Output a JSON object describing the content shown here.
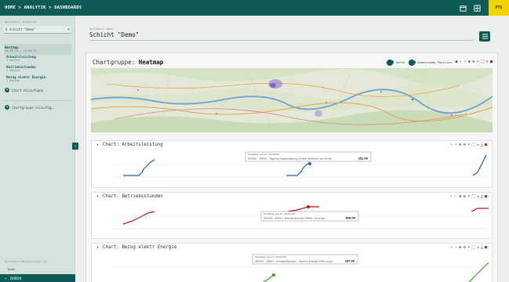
{
  "topbar": {
    "breadcrumb": "HOME > ANALYTIK > DASHBOARDS",
    "user": "PTS",
    "icons": [
      "calendar-icon",
      "grid-icon"
    ]
  },
  "sidebar": {
    "search_label": "Dashboard auswählen",
    "search_value": "Q Schicht \"Demo\"",
    "items": [
      {
        "label": "Heatmap",
        "sub": "20.05.25 - 19.05.25"
      },
      {
        "label": "Arbeitsleistung",
        "sub": "1 Balken"
      },
      {
        "label": "Betriebsstunden",
        "sub": "1 Balken"
      },
      {
        "label": "Bezug elektr Energie",
        "sub": "1 Balken"
      }
    ],
    "add_chart": "Chart hinzufügen",
    "add_group": "Chartgruppe hinzufüg…",
    "foot_text": "Dashboard-Reihenfolge (2)",
    "foot_text2": "Demo",
    "back_label": "ZURÜCK"
  },
  "dashboard": {
    "label": "Dashboard Name",
    "name": "Schicht \"Demo\""
  },
  "group": {
    "title_prefix": "Chartgruppe: ",
    "title_name": "Heatmap",
    "toggle1": "Karte",
    "toggle2": "Gemeinsame Position"
  },
  "charts": [
    {
      "title": "Chart:  Arbeitsleistung",
      "tooltip_date": "Samstag, Jan 11, 00:00:00",
      "tooltip_text": "Z00001 - Z0001 - Tägliche Arbeitsleistung (Quelle: Einheiten am Gerät)",
      "tooltip_value": "252.00"
    },
    {
      "title": "Chart:  Betriebsstunden",
      "tooltip_date": "Samstag, Jan 11, 00:00:00",
      "tooltip_text": "Z00001 - Z0001 - Betriebsstunden (Mittel, 1d (avg))",
      "tooltip_value": "898.00"
    },
    {
      "title": "Chart:  Bezug elektr Energie",
      "tooltip_date": "Samstag, Jan 11, 00:00:00",
      "tooltip_text": "Z00001 - Z0001 - Energie Bezugen - Tägliche Energie (kWh) (avg)",
      "tooltip_value": "187.00"
    }
  ],
  "colors": {
    "primary": "#0e5b56",
    "accent_yellow": "#f4d400",
    "series_blue": "#1f5db8",
    "series_red": "#c01818",
    "series_green": "#3c9a2a"
  }
}
